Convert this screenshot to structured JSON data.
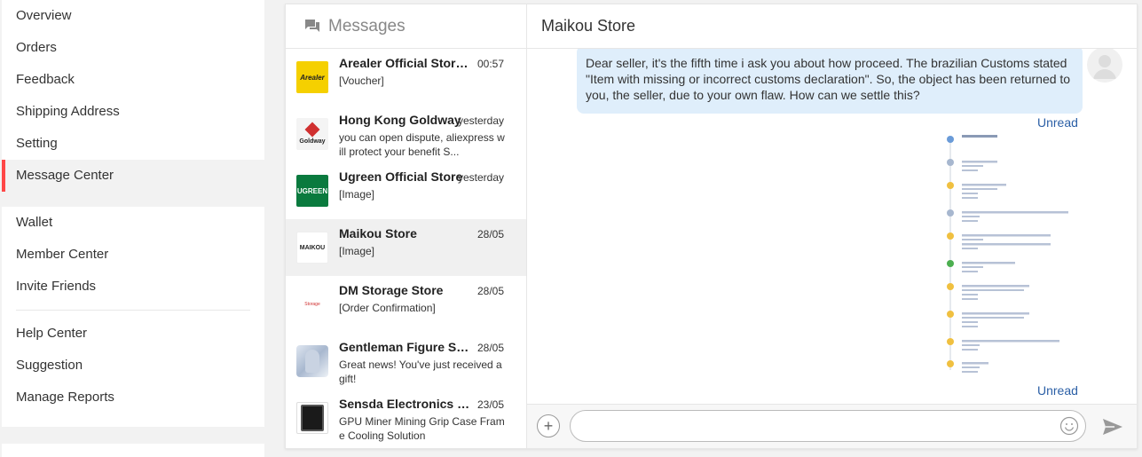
{
  "sidebar": {
    "group1": [
      "Overview",
      "Orders",
      "Feedback",
      "Shipping Address",
      "Setting",
      "Message Center"
    ],
    "group2": [
      "Wallet",
      "Member Center",
      "Invite Friends"
    ],
    "group3": [
      "Help Center",
      "Suggestion",
      "Manage Reports"
    ],
    "active": "Message Center"
  },
  "messages_panel": {
    "title": "Messages",
    "conversations": [
      {
        "name": "Arealer Official Store ...",
        "time": "00:57",
        "preview": "[Voucher]",
        "avatar_text": "Arealer"
      },
      {
        "name": "Hong Kong Goldway",
        "time": "yesterday",
        "preview": "you can open dispute, aliexpress w ill protect your benefit S...",
        "avatar_text": "Goldway"
      },
      {
        "name": "Ugreen Official Store",
        "time": "yesterday",
        "preview": "[Image]",
        "avatar_text": "UGREEN"
      },
      {
        "name": "Maikou Store",
        "time": "28/05",
        "preview": "[Image]",
        "avatar_text": "MAIKOU"
      },
      {
        "name": "DM Storage Store",
        "time": "28/05",
        "preview": "[Order Confirmation]",
        "avatar_text": "Storage"
      },
      {
        "name": "Gentleman Figure Store",
        "time": "28/05",
        "preview": "Great news! You've just received a gift!",
        "avatar_text": ""
      },
      {
        "name": "Sensda Electronics st...",
        "time": "23/05",
        "preview": "GPU Miner Mining Grip Case Fram e Cooling Solution",
        "avatar_text": ""
      }
    ]
  },
  "chat": {
    "store_name": "Maikou Store",
    "message_text": "Dear seller, it's the fifth time i ask you about how proceed. The brazilian Customs stated \"Item with missing or incorrect customs declaration\". So, the object has been returned to you, the seller, due to your own flaw. How can we settle this?",
    "status_1": "Unread",
    "status_2": "Unread",
    "input_placeholder": ""
  },
  "colors": {
    "accent_red": "#ff4747",
    "bubble_blue": "#dfeefb",
    "link_blue": "#2b5fa6"
  },
  "icons": [
    "messages-icon",
    "plus-icon",
    "emoji-icon",
    "send-icon",
    "user-avatar-icon"
  ]
}
